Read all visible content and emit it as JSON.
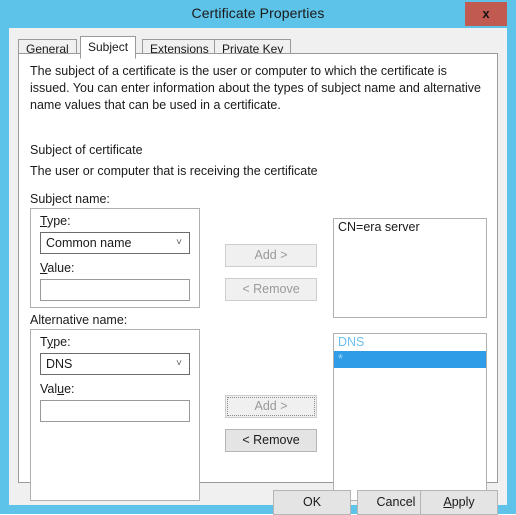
{
  "window": {
    "title": "Certificate Properties",
    "close_label": "x",
    "frame_color": "#5ec3e8",
    "close_color": "#c15b52"
  },
  "tabs": [
    {
      "label": "General",
      "active": false
    },
    {
      "label": "Subject",
      "active": true
    },
    {
      "label": "Extensions",
      "active": false
    },
    {
      "label": "Private Key",
      "active": false
    }
  ],
  "page": {
    "description": "The subject of a certificate is the user or computer to which the certificate is issued. You can enter information about the types of subject name and alternative name values that can be used in a certificate.",
    "subject_of_certificate_heading": "Subject of certificate",
    "subject_of_certificate_text": "The user or computer that is receiving the certificate"
  },
  "subject_name": {
    "group_label": "Subject name:",
    "type_label": "Type:",
    "type_accel": "T",
    "type_value": "Common name",
    "value_label": "Value:",
    "value_accel": "V",
    "value_text": "",
    "add_label": "Add >",
    "add_enabled": false,
    "remove_label": "< Remove",
    "remove_enabled": false,
    "list_items": [
      {
        "text": "CN=era server",
        "style": "normal"
      }
    ]
  },
  "alternative_name": {
    "group_label": "Alternative name:",
    "type_label": "Type:",
    "type_accel": "y",
    "type_value": "DNS",
    "value_label": "Value:",
    "value_accel": "u",
    "value_text": "",
    "add_label": "Add >",
    "add_enabled": false,
    "add_focused": true,
    "remove_label": "< Remove",
    "remove_enabled": true,
    "list_items": [
      {
        "text": "DNS",
        "style": "group"
      },
      {
        "text": "*",
        "style": "selected"
      }
    ]
  },
  "footer": {
    "ok_label": "OK",
    "cancel_label": "Cancel",
    "apply_label": "Apply",
    "apply_accel": "A"
  },
  "icons": {
    "chevron_down": "˅",
    "close": "x"
  }
}
